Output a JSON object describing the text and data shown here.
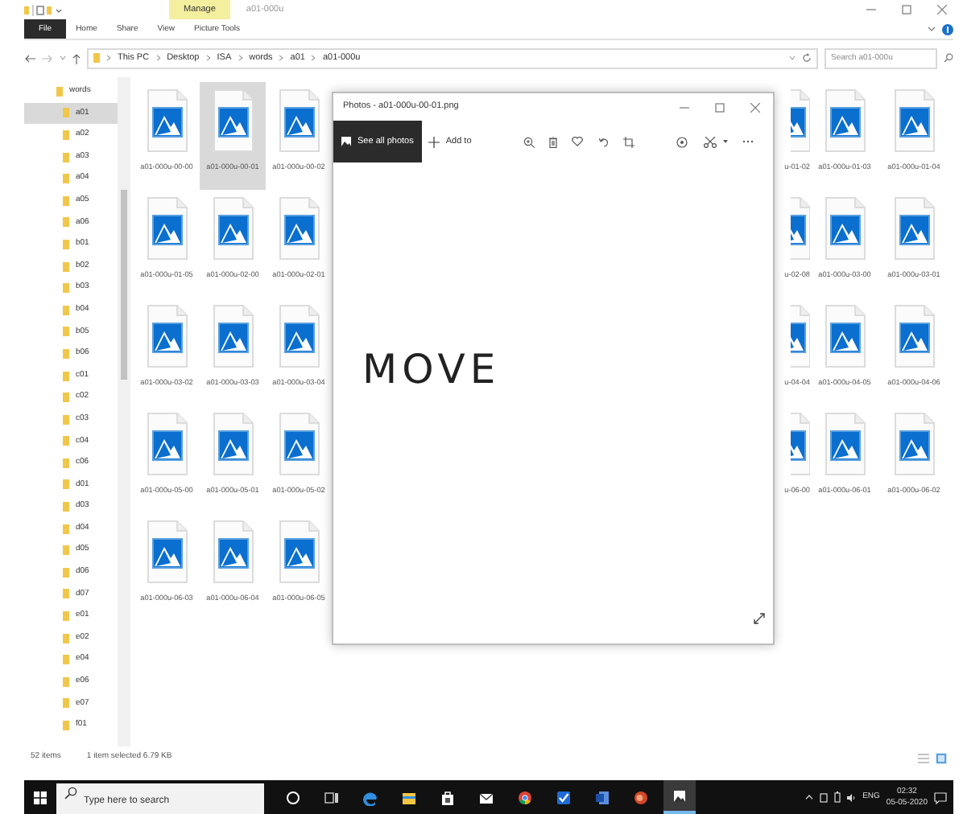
{
  "explorer": {
    "title": "a01-000u",
    "context_tab": "Manage",
    "ribbon_tabs": [
      {
        "label": "File",
        "kind": "file"
      },
      {
        "label": "Home",
        "kind": "tab"
      },
      {
        "label": "Share",
        "kind": "tab"
      },
      {
        "label": "View",
        "kind": "tab"
      },
      {
        "label": "Picture Tools",
        "kind": "tab"
      }
    ],
    "breadcrumb": [
      "This PC",
      "Desktop",
      "ISA",
      "words",
      "a01",
      "a01-000u"
    ],
    "search": {
      "placeholder": "Search a01-000u"
    },
    "nav_items": [
      {
        "label": "words",
        "selected": false,
        "children": [
          {
            "label": "a01",
            "selected": true
          },
          {
            "label": "a02",
            "selected": false
          },
          {
            "label": "a03",
            "selected": false
          },
          {
            "label": "a04",
            "selected": false
          },
          {
            "label": "a05",
            "selected": false
          },
          {
            "label": "a06",
            "selected": false
          },
          {
            "label": "b01",
            "selected": false
          },
          {
            "label": "b02",
            "selected": false
          },
          {
            "label": "b03",
            "selected": false
          },
          {
            "label": "b04",
            "selected": false
          },
          {
            "label": "b05",
            "selected": false
          },
          {
            "label": "b06",
            "selected": false
          },
          {
            "label": "c01",
            "selected": false
          },
          {
            "label": "c02",
            "selected": false
          },
          {
            "label": "c03",
            "selected": false
          },
          {
            "label": "c04",
            "selected": false
          },
          {
            "label": "c06",
            "selected": false
          },
          {
            "label": "d01",
            "selected": false
          },
          {
            "label": "d03",
            "selected": false
          },
          {
            "label": "d04",
            "selected": false
          },
          {
            "label": "d05",
            "selected": false
          },
          {
            "label": "d06",
            "selected": false
          },
          {
            "label": "d07",
            "selected": false
          },
          {
            "label": "e01",
            "selected": false
          },
          {
            "label": "e02",
            "selected": false
          },
          {
            "label": "e04",
            "selected": false
          },
          {
            "label": "e06",
            "selected": false
          },
          {
            "label": "e07",
            "selected": false
          },
          {
            "label": "f01",
            "selected": false
          }
        ]
      }
    ],
    "file_grid": {
      "left_columns": [
        {
          "name": "a01-000u-00-00",
          "selected": false
        },
        {
          "name": "a01-000u-00-01",
          "selected": true
        },
        {
          "name": "a01-000u-00-02",
          "selected": false
        },
        {
          "name": "a01-000u-01-05",
          "selected": false
        },
        {
          "name": "a01-000u-02-00",
          "selected": false
        },
        {
          "name": "a01-000u-02-01",
          "selected": false
        },
        {
          "name": "a01-000u-03-02",
          "selected": false
        },
        {
          "name": "a01-000u-03-03",
          "selected": false
        },
        {
          "name": "a01-000u-03-04",
          "selected": false
        },
        {
          "name": "a01-000u-05-00",
          "selected": false
        },
        {
          "name": "a01-000u-05-01",
          "selected": false
        },
        {
          "name": "a01-000u-05-02",
          "selected": false
        },
        {
          "name": "a01-000u-06-03",
          "selected": false
        },
        {
          "name": "a01-000u-06-04",
          "selected": false
        },
        {
          "name": "a01-000u-06-05",
          "selected": false
        }
      ],
      "clipped_column": [
        {
          "name": "u-01-02",
          "selected": false
        },
        {
          "name": "u-02-08",
          "selected": false
        },
        {
          "name": "u-04-04",
          "selected": false
        },
        {
          "name": "u-06-00",
          "selected": false
        }
      ],
      "right_columns": [
        {
          "name": "a01-000u-01-03",
          "selected": false
        },
        {
          "name": "a01-000u-01-04",
          "selected": false
        },
        {
          "name": "a01-000u-03-00",
          "selected": false
        },
        {
          "name": "a01-000u-03-01",
          "selected": false
        },
        {
          "name": "a01-000u-04-05",
          "selected": false
        },
        {
          "name": "a01-000u-04-06",
          "selected": false
        },
        {
          "name": "a01-000u-06-01",
          "selected": false
        },
        {
          "name": "a01-000u-06-02",
          "selected": false
        }
      ]
    },
    "status": {
      "count": "52 items",
      "selection": "1 item selected 6.79 KB"
    }
  },
  "photos": {
    "title": "Photos - a01-000u-00-01.png",
    "see_all": "See all photos",
    "add_to": "Add to",
    "image_text": "MOVE"
  },
  "taskbar": {
    "search": {
      "placeholder": "Type here to search"
    },
    "apps": [
      {
        "kind": "cortana",
        "active": false
      },
      {
        "kind": "taskview",
        "active": false
      },
      {
        "kind": "edge",
        "active": false
      },
      {
        "kind": "explorer",
        "active": false
      },
      {
        "kind": "store",
        "active": false
      },
      {
        "kind": "mail",
        "active": false
      },
      {
        "kind": "chrome",
        "active": false
      },
      {
        "kind": "check",
        "active": false
      },
      {
        "kind": "word",
        "active": false
      },
      {
        "kind": "red",
        "active": false
      },
      {
        "kind": "photos",
        "active": true
      }
    ],
    "language": "ENG",
    "time": "02:32",
    "date": "05-05-2020"
  }
}
